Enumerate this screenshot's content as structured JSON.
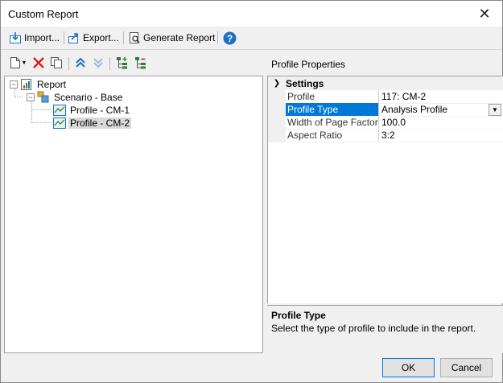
{
  "window": {
    "title": "Custom Report"
  },
  "toolbar": {
    "import_label": "Import...",
    "export_label": "Export...",
    "generate_label": "Generate Report"
  },
  "tree": {
    "root": "Report",
    "scenario": "Scenario - Base",
    "items": [
      "Profile - CM-1",
      "Profile - CM-2"
    ]
  },
  "properties": {
    "header": "Profile Properties",
    "category": "Settings",
    "rows": [
      {
        "name": "Profile",
        "value": "117: CM-2"
      },
      {
        "name": "Profile Type",
        "value": "Analysis Profile"
      },
      {
        "name": "Width of Page Factor (%",
        "value": "100.0"
      },
      {
        "name": "Aspect Ratio",
        "value": "3:2"
      }
    ]
  },
  "help": {
    "title": "Profile Type",
    "description": "Select the type of profile to include in the report."
  },
  "buttons": {
    "ok": "OK",
    "cancel": "Cancel"
  },
  "colors": {
    "selection": "#0078d7",
    "accent_blue": "#1f6fbf"
  }
}
